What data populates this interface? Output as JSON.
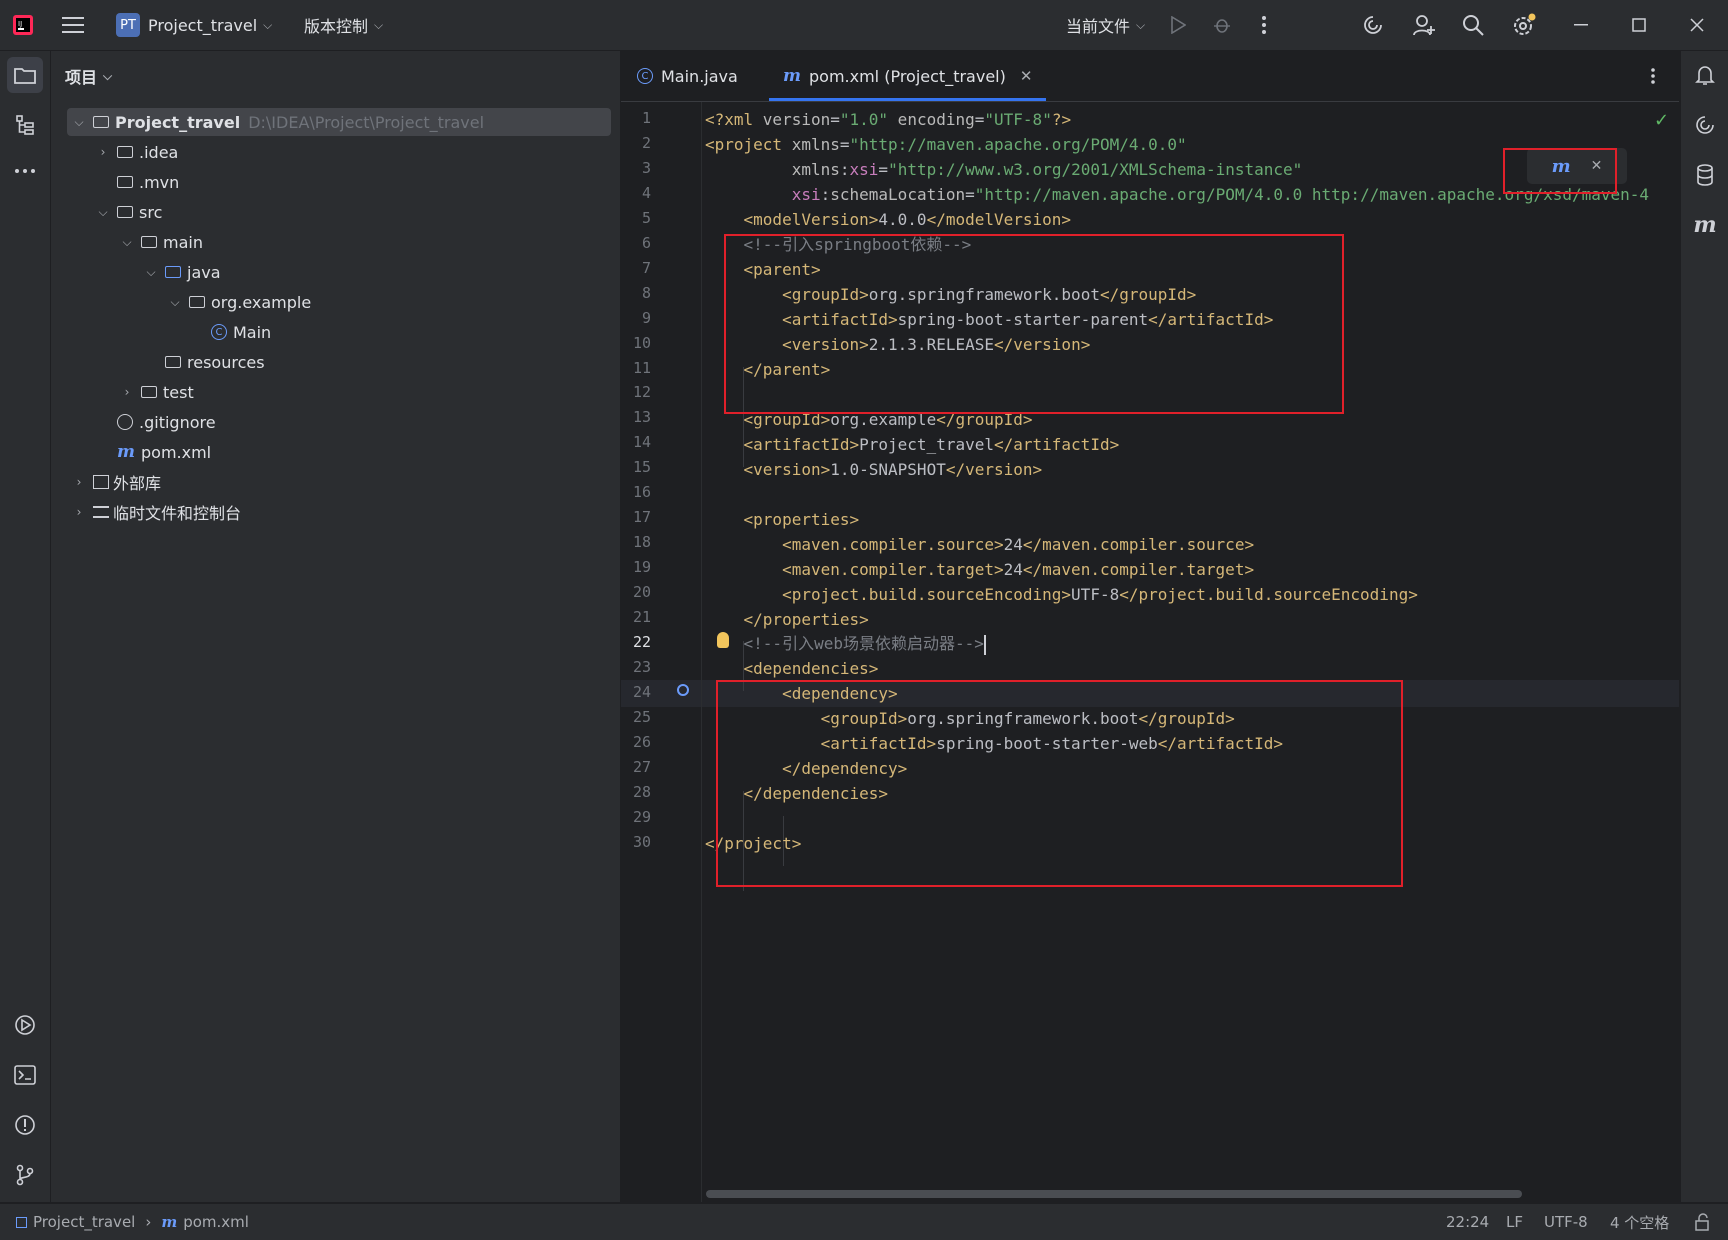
{
  "titlebar": {
    "project_badge": "PT",
    "project_name": "Project_travel",
    "vcs_label": "版本控制",
    "run_config": "当前文件"
  },
  "sidebar": {
    "header": "项目",
    "tree": [
      {
        "label": "Project_travel",
        "path": "D:\\IDEA\\Project\\Project_travel"
      },
      {
        "label": ".idea"
      },
      {
        "label": ".mvn"
      },
      {
        "label": "src"
      },
      {
        "label": "main"
      },
      {
        "label": "java"
      },
      {
        "label": "org.example"
      },
      {
        "label": "Main"
      },
      {
        "label": "resources"
      },
      {
        "label": "test"
      },
      {
        "label": ".gitignore"
      },
      {
        "label": "pom.xml",
        "icon_glyph": "m"
      },
      {
        "label": "外部库"
      },
      {
        "label": "临时文件和控制台"
      }
    ]
  },
  "tabs": [
    {
      "label": "Main.java"
    },
    {
      "label": "pom.xml (Project_travel)"
    }
  ],
  "editor": {
    "line_numbers": [
      "1",
      "2",
      "3",
      "4",
      "5",
      "6",
      "7",
      "8",
      "9",
      "10",
      "11",
      "12",
      "13",
      "14",
      "15",
      "16",
      "17",
      "18",
      "19",
      "20",
      "21",
      "22",
      "23",
      "24",
      "25",
      "26",
      "27",
      "28",
      "29",
      "30"
    ],
    "current_line": 22,
    "maven_reload_glyph": "m"
  },
  "statusbar": {
    "breadcrumb_project": "Project_travel",
    "breadcrumb_file": "pom.xml",
    "position": "22:24",
    "line_sep": "LF",
    "encoding": "UTF-8",
    "indent": "4 个空格"
  }
}
